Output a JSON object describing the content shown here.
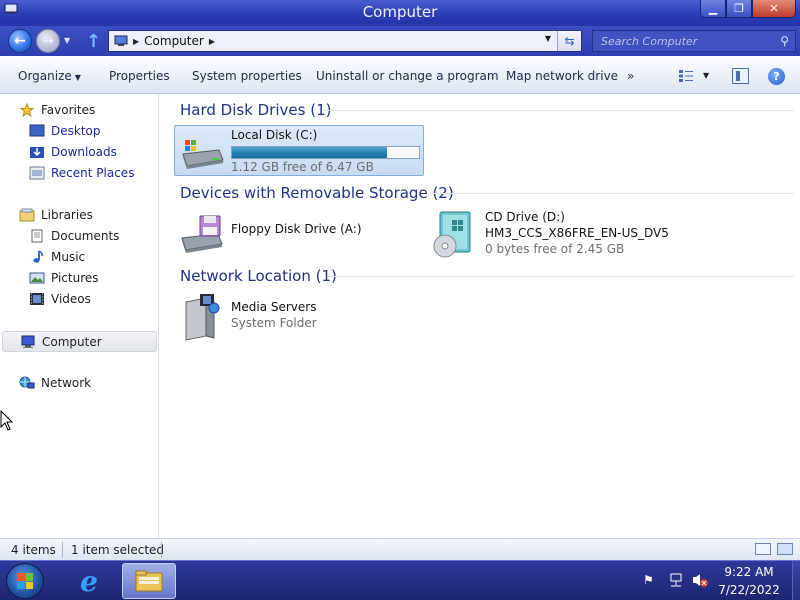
{
  "window": {
    "title": "Computer"
  },
  "address": {
    "breadcrumb": "Computer",
    "search_placeholder": "Search Computer"
  },
  "toolbar": {
    "organize": "Organize",
    "properties": "Properties",
    "system_properties": "System properties",
    "uninstall": "Uninstall or change a program",
    "map_drive": "Map network drive",
    "more": "»"
  },
  "sidebar": {
    "favorites": "Favorites",
    "desktop": "Desktop",
    "downloads": "Downloads",
    "recent_places": "Recent Places",
    "libraries": "Libraries",
    "documents": "Documents",
    "music": "Music",
    "pictures": "Pictures",
    "videos": "Videos",
    "computer": "Computer",
    "network": "Network"
  },
  "groups": {
    "hdd": "Hard Disk Drives (1)",
    "removable": "Devices with Removable Storage (2)",
    "network": "Network Location (1)"
  },
  "items": {
    "local_disk": {
      "name": "Local Disk (C:)",
      "free": "1.12 GB free of 6.47 GB",
      "used_fraction": 0.83
    },
    "floppy": {
      "name": "Floppy Disk Drive (A:)"
    },
    "cd": {
      "name": "CD Drive (D:)",
      "label": "HM3_CCS_X86FRE_EN-US_DV5",
      "free": "0 bytes free of 2.45 GB"
    },
    "media_servers": {
      "name": "Media Servers",
      "type": "System Folder"
    }
  },
  "status": {
    "item_count": "4 items",
    "selected": "1 item selected"
  },
  "taskbar": {
    "time": "9:22 AM",
    "date": "7/22/2022"
  },
  "colors": {
    "titlebar": "#2c3fb8",
    "taskbar": "#1c2570",
    "group_header": "#1e3287",
    "link": "#1a2a9a",
    "selection": "#c7dbf4"
  }
}
